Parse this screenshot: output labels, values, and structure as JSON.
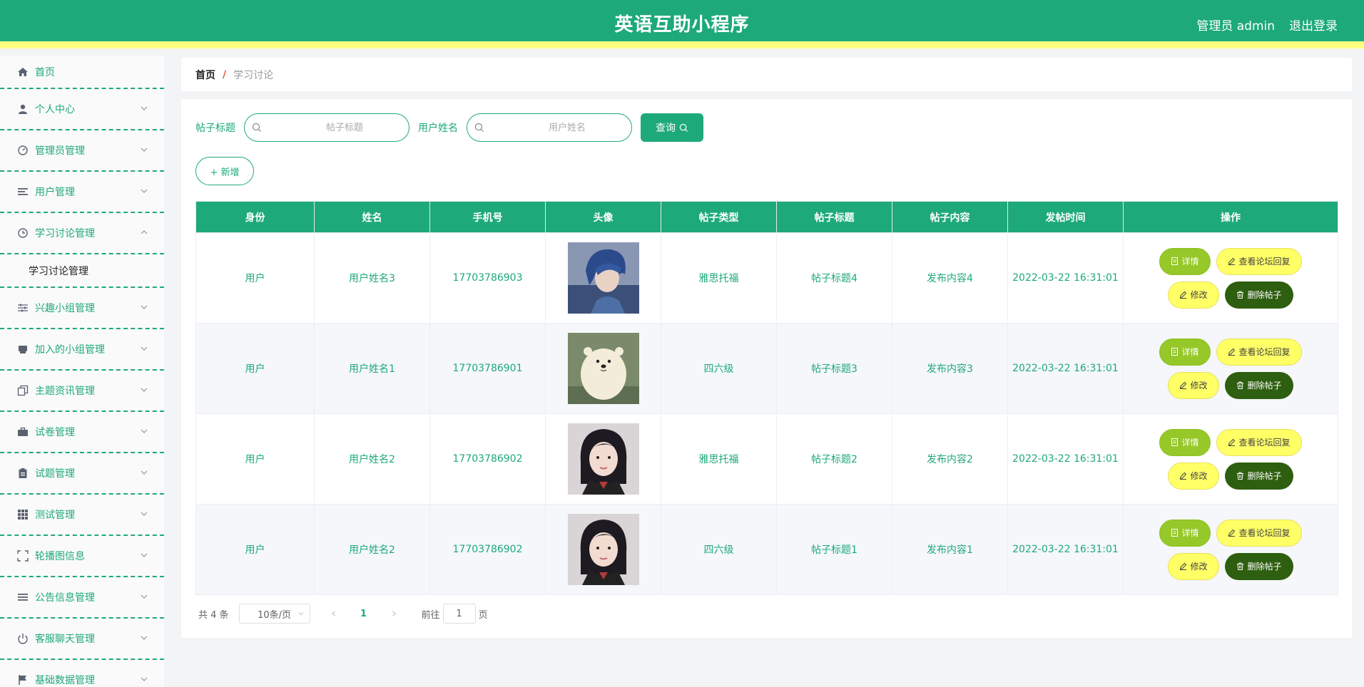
{
  "header": {
    "title": "英语互助小程序",
    "admin_label": "管理员 admin",
    "logout_label": "退出登录"
  },
  "sidebar": {
    "items": [
      {
        "label": "首页",
        "icon": "home-icon"
      },
      {
        "label": "个人中心",
        "icon": "user-icon"
      },
      {
        "label": "管理员管理",
        "icon": "gauge-icon"
      },
      {
        "label": "用户管理",
        "icon": "list-icon"
      },
      {
        "label": "学习讨论管理",
        "icon": "clock-icon"
      },
      {
        "label": "兴趣小组管理",
        "icon": "sliders-icon"
      },
      {
        "label": "加入的小组管理",
        "icon": "printer-icon"
      },
      {
        "label": "主题资讯管理",
        "icon": "copy-icon"
      },
      {
        "label": "试卷管理",
        "icon": "briefcase-icon"
      },
      {
        "label": "试题管理",
        "icon": "clipboard-icon"
      },
      {
        "label": "测试管理",
        "icon": "grid-icon"
      },
      {
        "label": "轮播图信息",
        "icon": "fullscreen-icon"
      },
      {
        "label": "公告信息管理",
        "icon": "list-icon"
      },
      {
        "label": "客服聊天管理",
        "icon": "power-icon"
      },
      {
        "label": "基础数据管理",
        "icon": "flag-icon"
      }
    ],
    "submenu_label": "学习讨论管理"
  },
  "breadcrumb": {
    "home": "首页",
    "separator": "/",
    "current": "学习讨论"
  },
  "search": {
    "title_label": "帖子标题",
    "title_placeholder": "帖子标题",
    "name_label": "用户姓名",
    "name_placeholder": "用户姓名",
    "query_label": "查询"
  },
  "add_label": "+ 新增",
  "table": {
    "headers": [
      "身份",
      "姓名",
      "手机号",
      "头像",
      "帖子类型",
      "帖子标题",
      "帖子内容",
      "发帖时间",
      "操作"
    ],
    "rows": [
      {
        "role": "用户",
        "name": "用户姓名3",
        "phone": "17703786903",
        "avatar": "blue-hair-boy",
        "type": "雅思托福",
        "title": "帖子标题4",
        "content": "发布内容4",
        "time": "2022-03-22 16:31:01"
      },
      {
        "role": "用户",
        "name": "用户姓名1",
        "phone": "17703786901",
        "avatar": "polar-bear",
        "type": "四六级",
        "title": "帖子标题3",
        "content": "发布内容3",
        "time": "2022-03-22 16:31:01"
      },
      {
        "role": "用户",
        "name": "用户姓名2",
        "phone": "17703786902",
        "avatar": "dark-hair-girl",
        "type": "雅思托福",
        "title": "帖子标题2",
        "content": "发布内容2",
        "time": "2022-03-22 16:31:01"
      },
      {
        "role": "用户",
        "name": "用户姓名2",
        "phone": "17703786902",
        "avatar": "dark-hair-girl",
        "type": "四六级",
        "title": "帖子标题1",
        "content": "发布内容1",
        "time": "2022-03-22 16:31:01"
      }
    ],
    "actions": {
      "detail": "详情",
      "reply": "查看论坛回复",
      "edit": "修改",
      "delete": "删除帖子"
    }
  },
  "pagination": {
    "total": "共 4 条",
    "page_size": "10条/页",
    "current_page": "1",
    "goto_prefix": "前往",
    "goto_value": "1",
    "goto_suffix": "页"
  },
  "colors": {
    "primary": "#1ea97b",
    "accent_yellow": "#ffff80",
    "detail_green": "#96c829",
    "delete_dark": "#2e5e0f"
  }
}
